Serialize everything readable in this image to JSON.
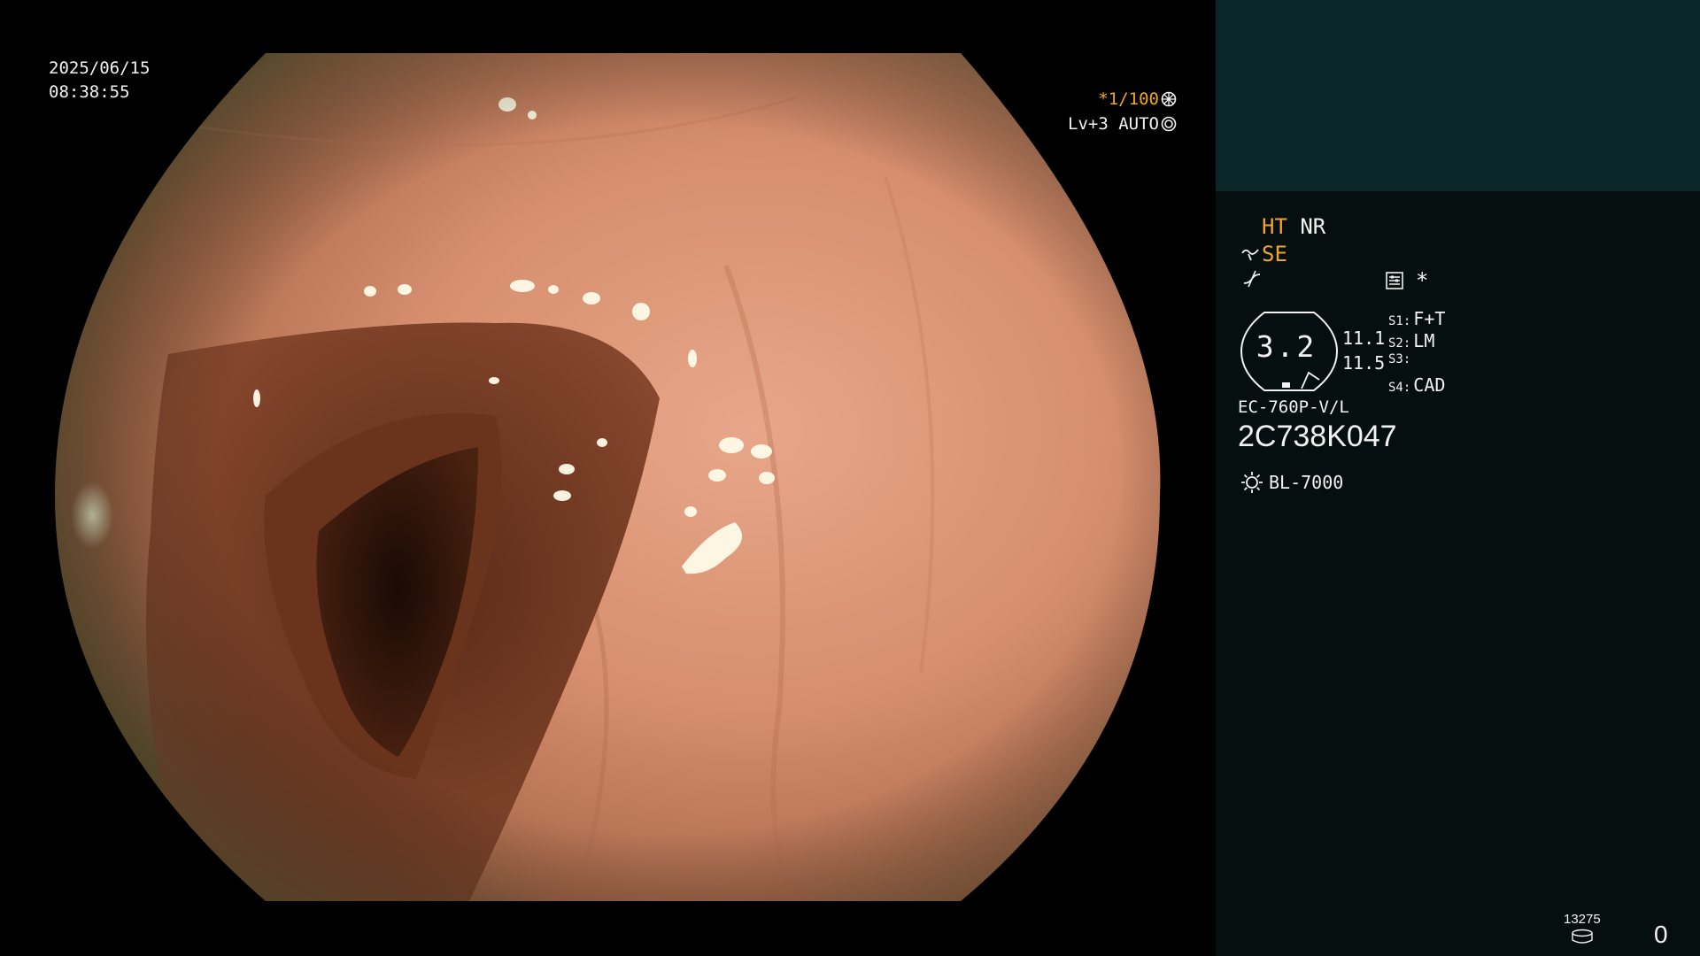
{
  "video": {
    "date": "2025/06/15",
    "time": "08:38:55",
    "shutter": "*1/100",
    "iris": "Lv+3 AUTO",
    "shutter_icon": "aperture-icon",
    "iris_icon": "ring-icon"
  },
  "panel": {
    "ht": "HT",
    "nr": "NR",
    "se": "SE",
    "se_icon": "tilde-scope-icon",
    "eq_icon": "filter-curve-icon",
    "preset_icon": "settings-card-icon",
    "star": "*",
    "gauge_value": "3.2",
    "value_a": "11.1",
    "value_b": "11.5",
    "slots": [
      {
        "key": "S1:",
        "value": "F+T"
      },
      {
        "key": "S2:",
        "value": "LM"
      },
      {
        "key": "S3:",
        "value": ""
      },
      {
        "key": "S4:",
        "value": "CAD"
      }
    ],
    "scope_model": "EC-760P-V/L",
    "scope_serial": "2C738K047",
    "light_source": "BL-7000",
    "light_icon": "sun-icon",
    "storage_count": "13275",
    "storage_icon": "disk-stack-icon",
    "frame_count": "0"
  },
  "colors": {
    "panel_bg": "#060f0f",
    "thumb_bg": "#0b2628",
    "amber": "#f0a42a",
    "text": "#f2f2f2"
  }
}
